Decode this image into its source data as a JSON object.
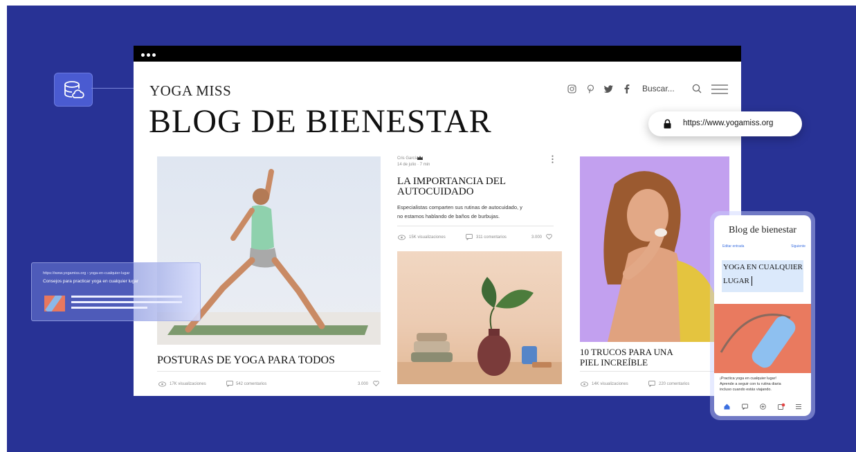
{
  "site": {
    "name": "YOGA MISS",
    "blog_title": "BLOG DE BIENESTAR",
    "search_label": "Buscar...",
    "url": "https://www.yogamiss.org"
  },
  "post_left": {
    "title": "POSTURAS DE YOGA PARA TODOS",
    "views": "17K visualizaciones",
    "comments": "542 comentarios",
    "likes": "3.000"
  },
  "post_center": {
    "author": "Cris García",
    "date": "14 de julio · 7 min",
    "title_line1": "LA IMPORTANCIA DEL",
    "title_line2": "AUTOCUIDADO",
    "excerpt_line1": "Especialistas comparten sus rutinas de autocuidado, y",
    "excerpt_line2": "no estamos hablando de baños de burbujas.",
    "views": "15K visualizaciones",
    "comments": "311 comentarios",
    "likes": "3.000"
  },
  "post_right": {
    "title_line1": "10 TRUCOS PARA UNA",
    "title_line2": "PIEL INCREÍBLE",
    "views": "14K visualizaciones",
    "comments": "220 comentarios"
  },
  "seo_card": {
    "url": "https://www.yogamiss.org › yoga-en-cualquier-lugar",
    "title": "Consejos para practicar yoga en cualquier lugar"
  },
  "mobile": {
    "title": "Blog de bienestar",
    "edit_label": "Editar entrada",
    "next_label": "Siguiente",
    "post_title_line1": "YOGA EN CUALQUIER",
    "post_title_line2": "LUGAR",
    "body_line1": "¡Practica yoga en cualquier lugar!",
    "body_line2": "Aprende a seguir con tu rutina diaria",
    "body_line3": "incluso cuando estás viajando."
  },
  "colors": {
    "background": "#283295",
    "accent": "#4a5bd1",
    "mobile_link": "#3b6fe0"
  },
  "icons": [
    "database-cloud-icon",
    "instagram-icon",
    "pinterest-icon",
    "twitter-icon",
    "facebook-icon",
    "search-icon",
    "menu-icon",
    "lock-icon",
    "eye-icon",
    "comment-icon",
    "heart-icon",
    "crown-icon",
    "more-icon",
    "home-icon",
    "chat-icon",
    "add-icon",
    "notifications-icon"
  ]
}
